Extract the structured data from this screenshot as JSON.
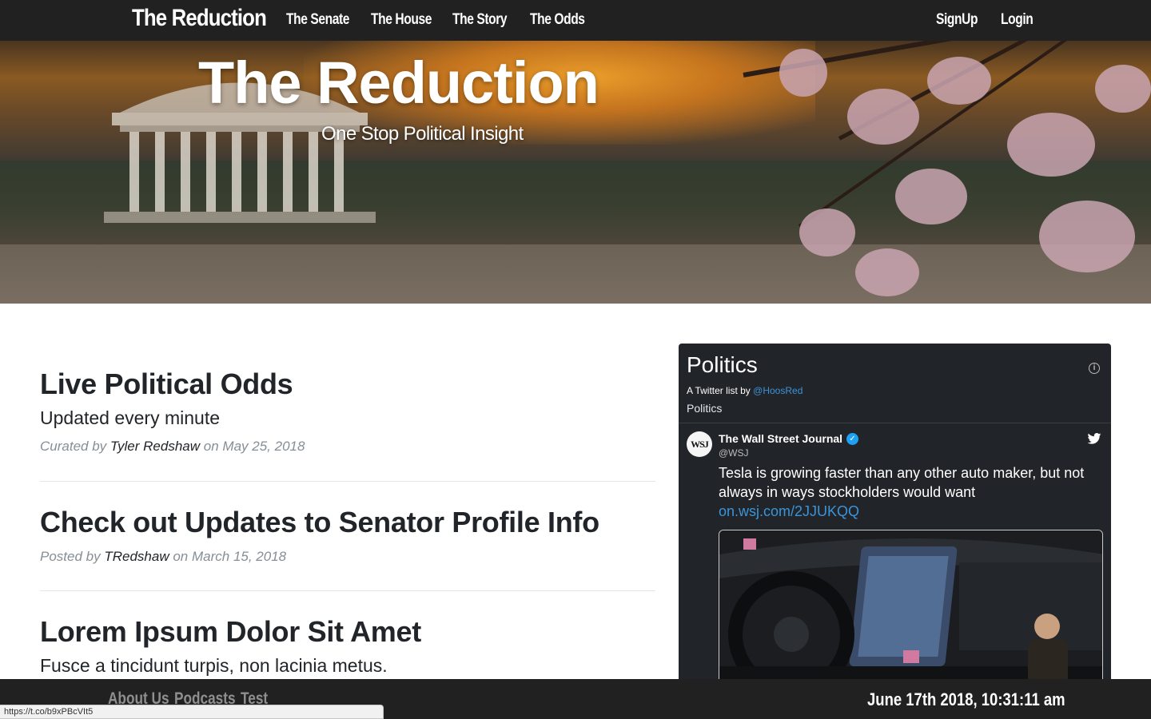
{
  "nav": {
    "brand": "The Reduction",
    "links": [
      "The Senate",
      "The House",
      "The Story",
      "The Odds"
    ],
    "signup": "SignUp",
    "login": "Login"
  },
  "hero": {
    "title": "The Reduction",
    "subtitle": "One Stop Political Insight"
  },
  "posts": [
    {
      "title": "Live Political Odds",
      "subtitle": "Updated every minute",
      "meta_prefix": "Curated by",
      "author": "Tyler Redshaw",
      "meta_on": "on",
      "date": "May 25, 2018"
    },
    {
      "title": "Check out Updates to Senator Profile Info",
      "meta_prefix": "Posted by",
      "author": "TRedshaw",
      "meta_on": "on",
      "date": "March 15, 2018"
    },
    {
      "title": "Lorem Ipsum Dolor Sit Amet",
      "subtitle": "Fusce a tincidunt turpis, non lacinia metus."
    }
  ],
  "twitter": {
    "list_title": "Politics",
    "by_prefix": "A Twitter list by",
    "by_handle": "@HoosRed",
    "list_name": "Politics",
    "tweet": {
      "avatar_text": "WSJ",
      "name": "The Wall Street Journal",
      "handle": "@WSJ",
      "text": "Tesla is growing faster than any other auto maker, but not always in ways stockholders would want",
      "link": "on.wsj.com/2JJUKQQ"
    },
    "colors": {
      "background": "#212529",
      "link": "#3b94d9",
      "verified": "#1da1f2"
    }
  },
  "footer": {
    "links": [
      "About Us",
      "Podcasts",
      "Test"
    ],
    "clock": "June 17th 2018, 10:31:11 am"
  },
  "status_bar": {
    "url": "https://t.co/b9xPBcVIt5"
  }
}
